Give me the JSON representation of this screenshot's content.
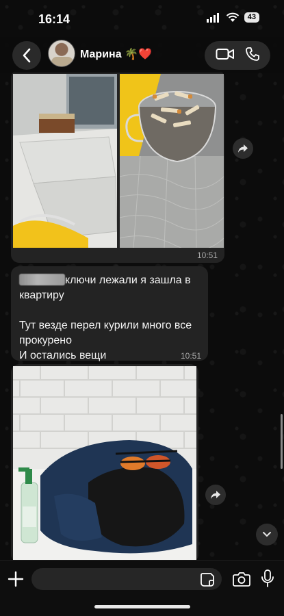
{
  "status_bar": {
    "time": "16:14",
    "battery_level": "43",
    "icons": [
      "signal-icon",
      "wifi-icon",
      "battery-icon"
    ]
  },
  "header": {
    "back_icon": "chevron-left-icon",
    "contact_name": "Марина 🌴❤️",
    "video_call_icon": "video-camera-icon",
    "voice_call_icon": "phone-icon"
  },
  "messages": [
    {
      "type": "image_pair",
      "images": [
        "photo of windowsill with matchbox",
        "photo of glass ashtray full of cigarette butts"
      ],
      "time": "10:51"
    },
    {
      "type": "text",
      "lines": [
        "ключи лежали я зашла в",
        "квартиру",
        "",
        "Тут везде перел курили много все",
        "прокурено",
        "И остались вещи"
      ],
      "time": "10:51"
    },
    {
      "type": "image",
      "images": [
        "photo of dark clothes, sunglasses and soap bottle on white brick wall background"
      ]
    }
  ],
  "composer": {
    "placeholder": "",
    "plus_icon": "plus-icon",
    "sticker_icon": "sticker-icon",
    "camera_icon": "camera-icon",
    "mic_icon": "microphone-icon"
  },
  "colors": {
    "background": "#0b0b0b",
    "bubble": "#232323",
    "timestamp": "#a8a8a8"
  }
}
